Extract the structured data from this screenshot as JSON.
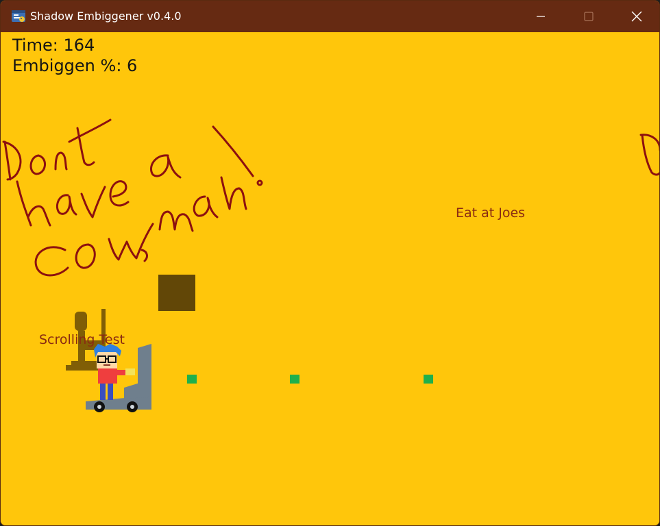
{
  "window": {
    "title": "Shadow Embiggener v0.4.0",
    "titlebar_color": "#662a12",
    "icon": "python-app-icon"
  },
  "hud": {
    "time_text": "Time: 164",
    "embiggen_text": "Embiggen %: 6"
  },
  "world": {
    "background_color": "#ffc60b",
    "graffiti_text": "Dont have a cow, man!",
    "sign_joes": "Eat at Joes",
    "sign_scrolling": "Scrolling Test",
    "sign_color": "#8a2a12",
    "crate_color": "#624707",
    "pellet_color": "#1fb04c"
  }
}
